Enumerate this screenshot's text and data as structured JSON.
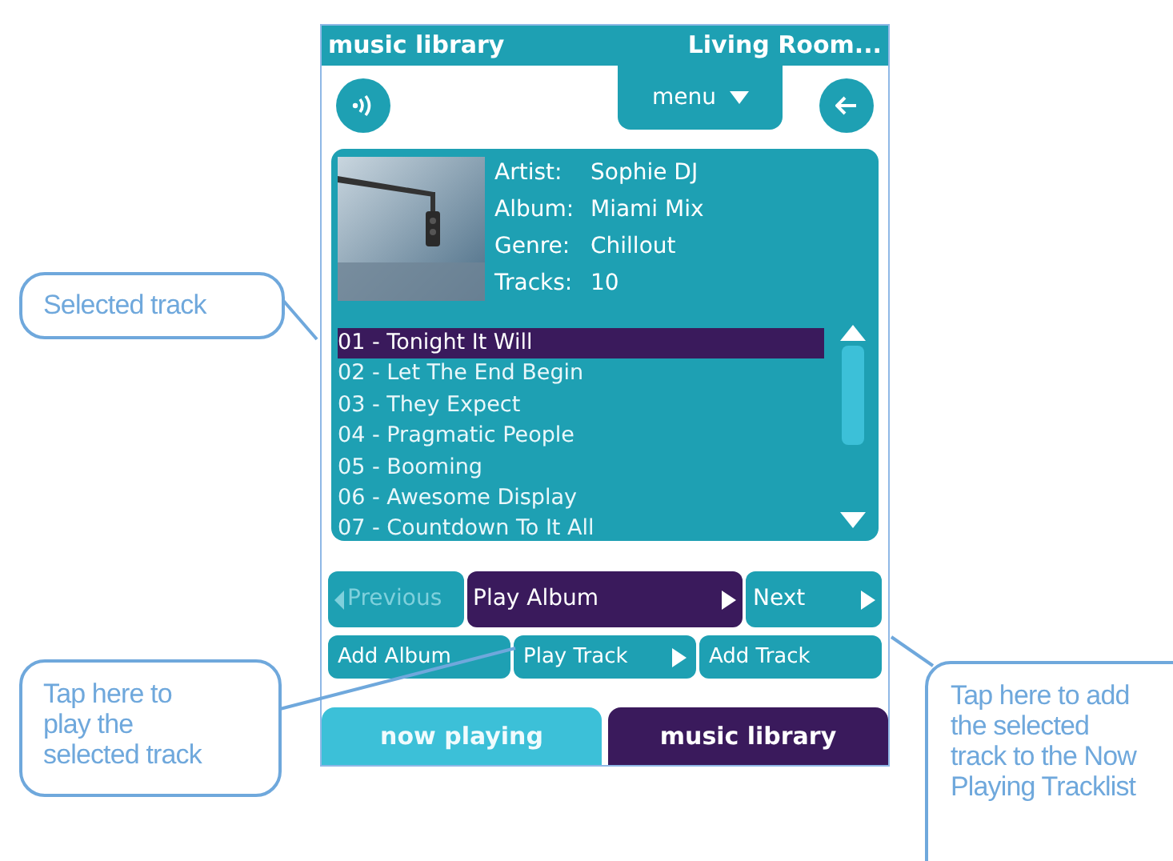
{
  "header": {
    "title": "music library",
    "location": "Living Room..."
  },
  "toolbar": {
    "menu": "menu"
  },
  "album": {
    "fields": [
      {
        "label": "Artist:",
        "value": "Sophie DJ"
      },
      {
        "label": "Album:",
        "value": "Miami Mix"
      },
      {
        "label": "Genre:",
        "value": "Chillout"
      },
      {
        "label": "Tracks:",
        "value": "10"
      }
    ]
  },
  "tracks": [
    {
      "title": "01 - Tonight It Will",
      "selected": true
    },
    {
      "title": "02 - Let The End Begin",
      "selected": false
    },
    {
      "title": "03 - They Expect",
      "selected": false
    },
    {
      "title": "04 - Pragmatic People",
      "selected": false
    },
    {
      "title": "05 - Booming",
      "selected": false
    },
    {
      "title": "06 - Awesome Display",
      "selected": false
    },
    {
      "title": "07 - Countdown To It All",
      "selected": false
    }
  ],
  "transport": [
    {
      "label": "Previous",
      "kind": "prev",
      "disabled": true
    },
    {
      "label": "Play Album",
      "kind": "primary",
      "disabled": false
    },
    {
      "label": "Next",
      "kind": "next",
      "disabled": false
    }
  ],
  "actions": [
    {
      "label": "Add Album",
      "arrow": false
    },
    {
      "label": "Play Track",
      "arrow": true
    },
    {
      "label": "Add Track",
      "arrow": false
    }
  ],
  "tabs": [
    {
      "label": "now playing",
      "selected": false
    },
    {
      "label": "music library",
      "selected": true
    }
  ],
  "annotations": [
    {
      "text": "Selected track"
    },
    {
      "text": "Tap here to play the selected track"
    },
    {
      "text": "Tap here to add the selected track to the Now Playing Tracklist"
    }
  ]
}
